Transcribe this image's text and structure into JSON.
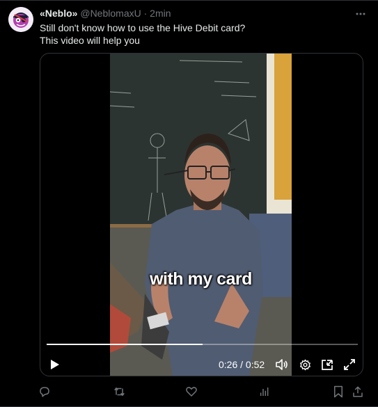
{
  "tweet": {
    "display_name": "«Neblo»",
    "handle": "@NeblomaxU",
    "separator": "·",
    "time": "2min",
    "text_line1": "Still don't know how to use the Hive Debit card?",
    "text_line2": "This video will help you"
  },
  "video": {
    "caption": "with my card",
    "timecode": "0:26 / 0:52",
    "progress": 0.5,
    "icons": [
      "play-icon",
      "volume-icon",
      "settings-icon",
      "picture-in-picture-icon",
      "fullscreen-icon"
    ]
  },
  "actions": {
    "icons": [
      "reply-icon",
      "repost-icon",
      "like-icon",
      "views-icon",
      "bookmark-icon",
      "share-icon"
    ]
  },
  "colors": {
    "background": "#000000",
    "text": "#e7e9ea",
    "muted": "#71767b",
    "border": "#2f3336"
  }
}
